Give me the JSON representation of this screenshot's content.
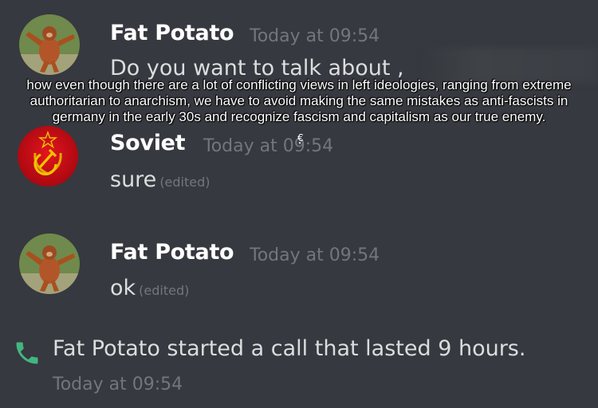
{
  "messages": [
    {
      "author": "Fat Potato",
      "timestamp": "Today at 09:54",
      "text": "Do you want to talk about ,",
      "edited": "",
      "avatar_icon": "orangutan-avatar-icon"
    },
    {
      "author": "Soviet",
      "timestamp": "Today at 09:54",
      "text": "sure",
      "edited": "(edited)",
      "avatar_icon": "hammer-sickle-avatar-icon"
    },
    {
      "author": "Fat Potato",
      "timestamp": "Today at 09:54",
      "text": "ok",
      "edited": "(edited)",
      "avatar_icon": "orangutan-avatar-icon"
    }
  ],
  "caption": "how even though there are a lot of conflicting views in left ideologies, ranging from extreme authoritarian to anarchism, we have to avoid making the same mistakes as anti-fascists in germany in the early 30s and recognize fascism and capitalism as our true enemy.",
  "glitch_glyphs": "€\n˟",
  "call": {
    "text": "Fat Potato started a call that lasted 9 hours.",
    "timestamp": "Today at 09:54",
    "icon": "phone-icon",
    "icon_color": "#43b581"
  },
  "colors": {
    "background": "#36393f",
    "username": "#ffffff",
    "timestamp": "#72767d",
    "message_text": "#dcddde",
    "soviet_red": "#c8102e",
    "emblem_gold": "#f2c300"
  }
}
